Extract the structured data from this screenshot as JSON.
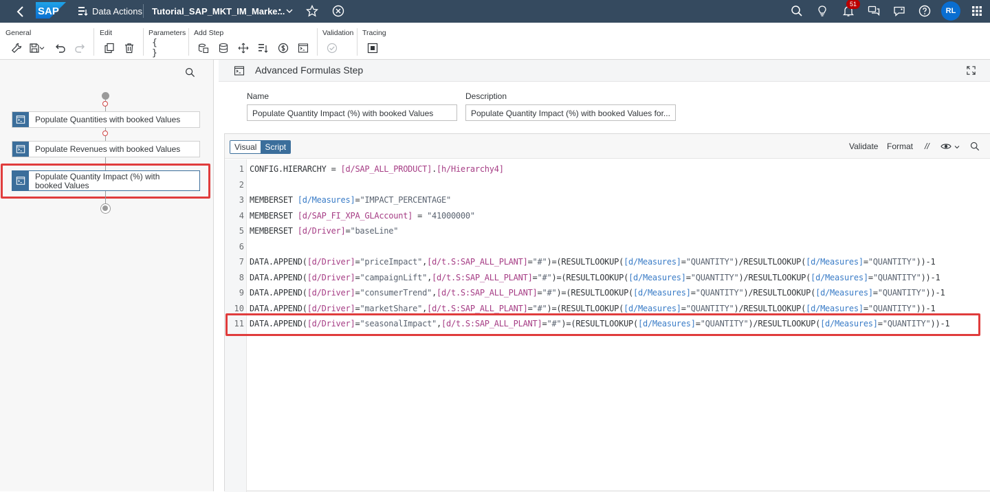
{
  "shell": {
    "logo": "SAP",
    "app_label": "Data Actions",
    "story_title": "Tutorial_SAP_MKT_IM_Marke...",
    "modified_dot": "•",
    "notification_count": "51",
    "avatar_initials": "RL"
  },
  "toolbar": {
    "general": "General",
    "edit": "Edit",
    "parameters": "Parameters",
    "parameters_glyph": "{ }",
    "add_step": "Add Step",
    "validation": "Validation",
    "tracing": "Tracing"
  },
  "flow": {
    "steps": [
      {
        "label": "Populate Quantities with booked Values"
      },
      {
        "label": "Populate Revenues with booked Values"
      },
      {
        "label": "Populate Quantity Impact (%) with booked Values"
      }
    ]
  },
  "step_panel": {
    "title": "Advanced Formulas Step",
    "name_label": "Name",
    "name_value": "Populate Quantity Impact (%) with booked Values",
    "description_label": "Description",
    "description_value": "Populate Quantity Impact (%) with booked Values for..."
  },
  "editor": {
    "tab_visual": "Visual",
    "tab_script": "Script",
    "validate": "Validate",
    "format": "Format",
    "comment": "//",
    "line_numbers": [
      "1",
      "2",
      "3",
      "4",
      "5",
      "6",
      "7",
      "8",
      "9",
      "10",
      "11"
    ],
    "lines": [
      "CONFIG.HIERARCHY = [d/SAP_ALL_PRODUCT].[h/Hierarchy4]",
      "",
      "MEMBERSET [d/Measures]=\"IMPACT_PERCENTAGE\"",
      "MEMBERSET [d/SAP_FI_XPA_GLAccount] = \"41000000\"",
      "MEMBERSET [d/Driver]=\"baseLine\"",
      "",
      "DATA.APPEND([d/Driver]=\"priceImpact\",[d/t.S:SAP_ALL_PLANT]=\"#\")=(RESULTLOOKUP([d/Measures]=\"QUANTITY\")/RESULTLOOKUP([d/Measures]=\"QUANTITY\"))-1",
      "DATA.APPEND([d/Driver]=\"campaignLift\",[d/t.S:SAP_ALL_PLANT]=\"#\")=(RESULTLOOKUP([d/Measures]=\"QUANTITY\")/RESULTLOOKUP([d/Measures]=\"QUANTITY\"))-1",
      "DATA.APPEND([d/Driver]=\"consumerTrend\",[d/t.S:SAP_ALL_PLANT]=\"#\")=(RESULTLOOKUP([d/Measures]=\"QUANTITY\")/RESULTLOOKUP([d/Measures]=\"QUANTITY\"))-1",
      "DATA.APPEND([d/Driver]=\"marketShare\",[d/t.S:SAP_ALL_PLANT]=\"#\")=(RESULTLOOKUP([d/Measures]=\"QUANTITY\")/RESULTLOOKUP([d/Measures]=\"QUANTITY\"))-1",
      "DATA.APPEND([d/Driver]=\"seasonalImpact\",[d/t.S:SAP_ALL_PLANT]=\"#\")=(RESULTLOOKUP([d/Measures]=\"QUANTITY\")/RESULTLOOKUP([d/Measures]=\"QUANTITY\"))-1"
    ]
  },
  "colors": {
    "shell": "#354a5f",
    "accent": "#3b6e9b",
    "highlight": "#e03c3c",
    "dimension": "#a63d85",
    "measure": "#3a7cc7"
  }
}
